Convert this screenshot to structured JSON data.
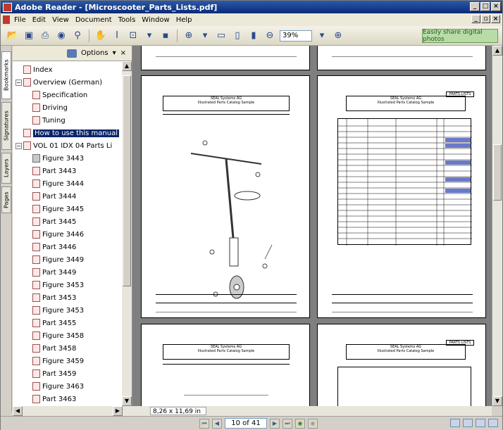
{
  "window": {
    "title": "Adobe Reader - [Microscooter_Parts_Lists.pdf]"
  },
  "menu": [
    "File",
    "Edit",
    "View",
    "Document",
    "Tools",
    "Window",
    "Help"
  ],
  "toolbar": {
    "zoom_value": "39%",
    "promo_label": "Easily share digital photos"
  },
  "nav_tabs": [
    "Bookmarks",
    "Signatures",
    "Layers",
    "Pages"
  ],
  "panel": {
    "options_label": "Options",
    "close_label": "×"
  },
  "bookmarks": [
    {
      "label": "Index",
      "level": 1,
      "expander": "",
      "type": "bm"
    },
    {
      "label": "Overview (German)",
      "level": 1,
      "expander": "−",
      "type": "bm"
    },
    {
      "label": "Specification",
      "level": 2,
      "expander": "",
      "type": "bm"
    },
    {
      "label": "Driving",
      "level": 2,
      "expander": "",
      "type": "bm"
    },
    {
      "label": "Tuning",
      "level": 2,
      "expander": "",
      "type": "bm"
    },
    {
      "label": "How to use this manual",
      "level": 1,
      "expander": "",
      "type": "bm",
      "selected": true
    },
    {
      "label": "VOL 01 IDX 04 Parts Li",
      "level": 1,
      "expander": "−",
      "type": "bm"
    },
    {
      "label": "Figure 3443",
      "level": 2,
      "expander": "",
      "type": "fig"
    },
    {
      "label": "Part 3443",
      "level": 2,
      "expander": "",
      "type": "bm"
    },
    {
      "label": "Figure 3444",
      "level": 2,
      "expander": "",
      "type": "bm"
    },
    {
      "label": "Part 3444",
      "level": 2,
      "expander": "",
      "type": "bm"
    },
    {
      "label": "Figure 3445",
      "level": 2,
      "expander": "",
      "type": "bm"
    },
    {
      "label": "Part 3445",
      "level": 2,
      "expander": "",
      "type": "bm"
    },
    {
      "label": "Figure 3446",
      "level": 2,
      "expander": "",
      "type": "bm"
    },
    {
      "label": "Part 3446",
      "level": 2,
      "expander": "",
      "type": "bm"
    },
    {
      "label": "Figure 3449",
      "level": 2,
      "expander": "",
      "type": "bm"
    },
    {
      "label": "Part 3449",
      "level": 2,
      "expander": "",
      "type": "bm"
    },
    {
      "label": "Figure 3453",
      "level": 2,
      "expander": "",
      "type": "bm"
    },
    {
      "label": "Part 3453",
      "level": 2,
      "expander": "",
      "type": "bm"
    },
    {
      "label": "Figure 3453",
      "level": 2,
      "expander": "",
      "type": "bm"
    },
    {
      "label": "Part 3455",
      "level": 2,
      "expander": "",
      "type": "bm"
    },
    {
      "label": "Figure 3458",
      "level": 2,
      "expander": "",
      "type": "bm"
    },
    {
      "label": "Part 3458",
      "level": 2,
      "expander": "",
      "type": "bm"
    },
    {
      "label": "Figure 3459",
      "level": 2,
      "expander": "",
      "type": "bm"
    },
    {
      "label": "Part 3459",
      "level": 2,
      "expander": "",
      "type": "bm"
    },
    {
      "label": "Figure 3463",
      "level": 2,
      "expander": "",
      "type": "bm"
    },
    {
      "label": "Part 3463",
      "level": 2,
      "expander": "",
      "type": "bm"
    }
  ],
  "document": {
    "page_size": "8,26 x 11,69 in",
    "page_header_company": "SEAL Systems AG",
    "page_header_catalog": "Illustrated Parts Catalog Sample",
    "parts_list_tag": "PARTS LISTS"
  },
  "statusbar": {
    "page_indicator": "10 of 41"
  }
}
